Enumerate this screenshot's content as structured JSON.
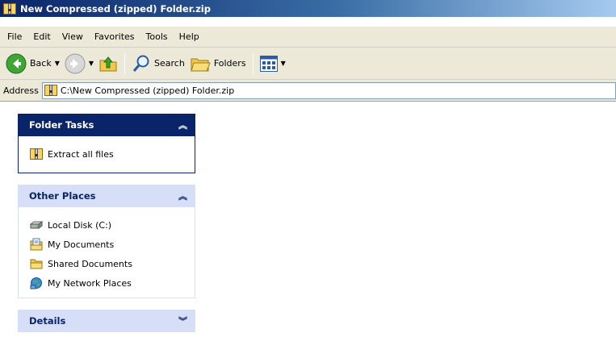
{
  "window": {
    "title": "New Compressed (zipped) Folder.zip"
  },
  "menu": [
    "File",
    "Edit",
    "View",
    "Favorites",
    "Tools",
    "Help"
  ],
  "toolbar": {
    "back_label": "Back",
    "search_label": "Search",
    "folders_label": "Folders"
  },
  "address": {
    "label": "Address",
    "value": "C:\\New Compressed (zipped) Folder.zip"
  },
  "panels": {
    "folder_tasks": {
      "title": "Folder Tasks",
      "items": [
        "Extract all files"
      ]
    },
    "other_places": {
      "title": "Other Places",
      "items": [
        "Local Disk (C:)",
        "My Documents",
        "Shared Documents",
        "My Network Places"
      ]
    },
    "details": {
      "title": "Details"
    }
  },
  "colors": {
    "panel_dark": "#0a246a",
    "panel_light": "#d6dff7",
    "chrome": "#ece9d8"
  }
}
